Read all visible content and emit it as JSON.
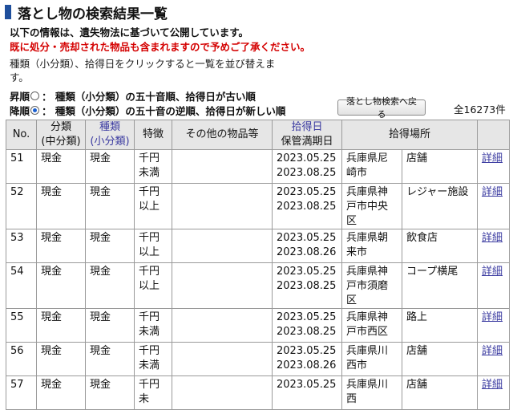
{
  "page": {
    "title": "落とし物の検索結果一覧",
    "notice_line1": "以下の情報は、遺失物法に基づいて公開しています。",
    "notice_line2": "既に処分・売却された物品も含まれますので予めご了承ください。",
    "sort_desc_line1": "種類（小分類）、拾得日をクリックすると一覧を並び替えま",
    "sort_desc_line2": "す。",
    "asc_label": "昇順",
    "asc_text": "：  種類（小分類）の五十音順、拾得日が古い順",
    "desc_label": "降順",
    "desc_text": "：  種類（小分類）の五十音の逆順、拾得日が新しい順",
    "sort_selected": "降順",
    "back_button": "落とし物検索へ戻る",
    "total": "全16273件"
  },
  "table": {
    "headers": {
      "no": "No.",
      "bunrui1": "分類",
      "bunrui2": "(中分類)",
      "shurui1": "種類",
      "shurui2": "(小分類)",
      "tokucho": "特徴",
      "other": "その他の物品等",
      "date1": "拾得日",
      "date2": "保管満期日",
      "place": "拾得場所",
      "detail": ""
    },
    "rows": [
      {
        "no": "51",
        "bunrui": "現金",
        "shurui": "現金",
        "tokucho": "千円未満",
        "other": "",
        "date": "2023.05.25",
        "expire": "2023.08.25",
        "pref": "兵庫県尼崎市",
        "place": "店舗",
        "detail": "詳細"
      },
      {
        "no": "52",
        "bunrui": "現金",
        "shurui": "現金",
        "tokucho": "千円以上",
        "other": "",
        "date": "2023.05.25",
        "expire": "2023.08.25",
        "pref": "兵庫県神戸市中央区",
        "place": "レジャー施設",
        "detail": "詳細"
      },
      {
        "no": "53",
        "bunrui": "現金",
        "shurui": "現金",
        "tokucho": "千円以上",
        "other": "",
        "date": "2023.05.25",
        "expire": "2023.08.26",
        "pref": "兵庫県朝来市",
        "place": "飲食店",
        "detail": "詳細"
      },
      {
        "no": "54",
        "bunrui": "現金",
        "shurui": "現金",
        "tokucho": "千円以上",
        "other": "",
        "date": "2023.05.25",
        "expire": "2023.08.25",
        "pref": "兵庫県神戸市須磨区",
        "place": "コープ横尾",
        "detail": "詳細"
      },
      {
        "no": "55",
        "bunrui": "現金",
        "shurui": "現金",
        "tokucho": "千円未満",
        "other": "",
        "date": "2023.05.25",
        "expire": "2023.08.25",
        "pref": "兵庫県神戸市西区",
        "place": "路上",
        "detail": "詳細"
      },
      {
        "no": "56",
        "bunrui": "現金",
        "shurui": "現金",
        "tokucho": "千円未満",
        "other": "",
        "date": "2023.05.25",
        "expire": "2023.08.26",
        "pref": "兵庫県川西市",
        "place": "店舗",
        "detail": "詳細"
      },
      {
        "no": "57",
        "bunrui": "現金",
        "shurui": "現金",
        "tokucho": "千円未",
        "other": "",
        "date": "2023.05.25",
        "expire": "",
        "pref": "兵庫県川西",
        "place": "店舗",
        "detail": "詳細"
      }
    ]
  }
}
